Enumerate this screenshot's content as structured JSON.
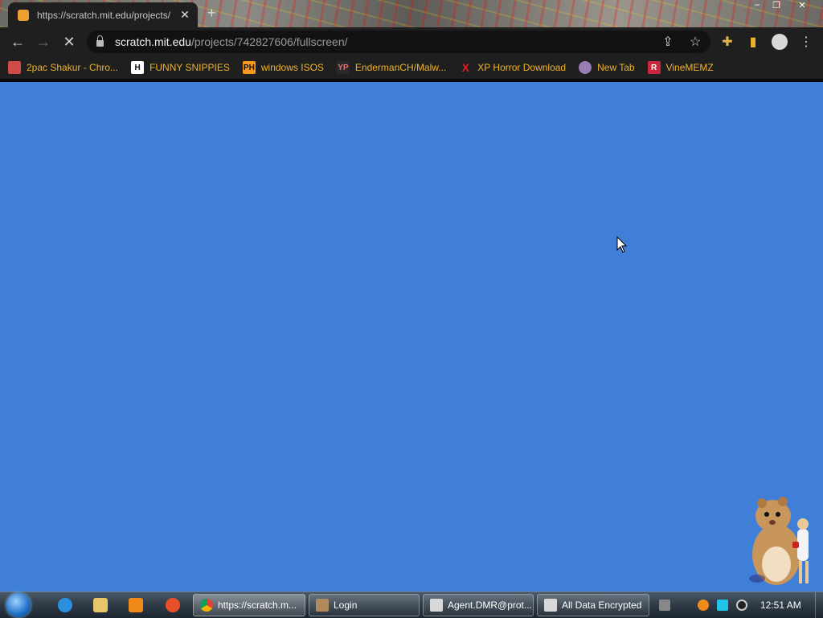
{
  "browser": {
    "tab": {
      "title": "https://scratch.mit.edu/projects/",
      "close": "✕"
    },
    "new_tab": "+",
    "window_controls": {
      "minimize": "–",
      "maximize": "❐",
      "close": "✕"
    },
    "nav": {
      "back": "←",
      "forward": "→",
      "stop": "✕"
    },
    "address": {
      "host": "scratch.mit.edu",
      "path": "/projects/742827606/fullscreen/"
    },
    "toolbar_icons": {
      "share": "⇪",
      "bookmark": "☆",
      "extensions": "✚",
      "sidepanel": "▮",
      "menu": "⋮"
    }
  },
  "bookmarks": [
    {
      "label": "2pac Shakur - Chro...",
      "icon": "film-icon",
      "icon_text": "",
      "color": "#d04a4a"
    },
    {
      "label": "FUNNY SNIPPIES",
      "icon": "h-icon",
      "icon_text": "H",
      "color": "#ffffff"
    },
    {
      "label": "windows ISOS",
      "icon": "ph-icon",
      "icon_text": "PH",
      "color": "#f7971d"
    },
    {
      "label": "EndermanCH/Malw...",
      "icon": "yp-icon",
      "icon_text": "YP",
      "color": "#2a2a2a"
    },
    {
      "label": "XP Horror Download",
      "icon": "x-icon",
      "icon_text": "X",
      "color": "#1f1f1f"
    },
    {
      "label": "New Tab",
      "icon": "globe-icon",
      "icon_text": "",
      "color": "#9a7db5"
    },
    {
      "label": "VineMEMZ",
      "icon": "r-icon",
      "icon_text": "R",
      "color": "#c8283c"
    }
  ],
  "page": {
    "background": "#3f7fd8"
  },
  "taskbar": {
    "tasks": [
      {
        "label": "https://scratch.m...",
        "icon": "chrome-icon",
        "active": true
      },
      {
        "label": "Login",
        "icon": "login-icon",
        "active": false
      },
      {
        "label": "Agent.DMR@prot...",
        "icon": "window-icon",
        "active": false
      },
      {
        "label": "All Data Encrypted",
        "icon": "window-icon",
        "active": false
      }
    ],
    "clock": "12:51 AM"
  }
}
